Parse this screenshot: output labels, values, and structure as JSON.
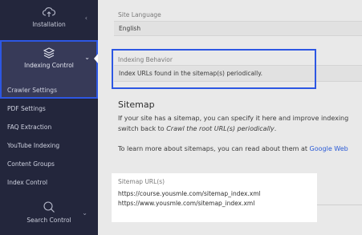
{
  "sidebar": {
    "installation": {
      "label": "Installation",
      "icon": "cloud-upload-icon"
    },
    "indexing_control": {
      "label": "Indexing Control",
      "icon": "layers-icon"
    },
    "sub_items": [
      {
        "label": "Crawler Settings"
      },
      {
        "label": "PDF Settings"
      },
      {
        "label": "FAQ Extraction"
      },
      {
        "label": "YouTube Indexing"
      },
      {
        "label": "Content Groups"
      },
      {
        "label": "Index Control"
      }
    ],
    "search_control": {
      "label": "Search Control",
      "icon": "search-icon"
    }
  },
  "main": {
    "site_language": {
      "label": "Site Language",
      "value": "English"
    },
    "indexing_behavior": {
      "label": "Indexing Behavior",
      "value": "Index URLs found in the sitemap(s) periodically."
    },
    "sitemap_section": {
      "title": "Sitemap",
      "line1": "If your site has a sitemap, you can specify it here and improve indexing",
      "line2_prefix": "switch back to ",
      "line2_em": "Crawl the root URL(s) periodically",
      "line2_suffix": ".",
      "line3_prefix": "To learn more about sitemaps, you can read about them at ",
      "line3_link": "Google Web"
    },
    "sitemap_urls": {
      "label": "Sitemap URL(s)",
      "urls": [
        "https://course.yousmle.com/sitemap_index.xml",
        "https://www.yousmle.com/sitemap_index.xml"
      ]
    }
  },
  "colors": {
    "sidebar_bg": "#23263c",
    "active_bg": "#373a58",
    "highlight_border": "#2d57e3",
    "link": "#2b5bd6"
  }
}
